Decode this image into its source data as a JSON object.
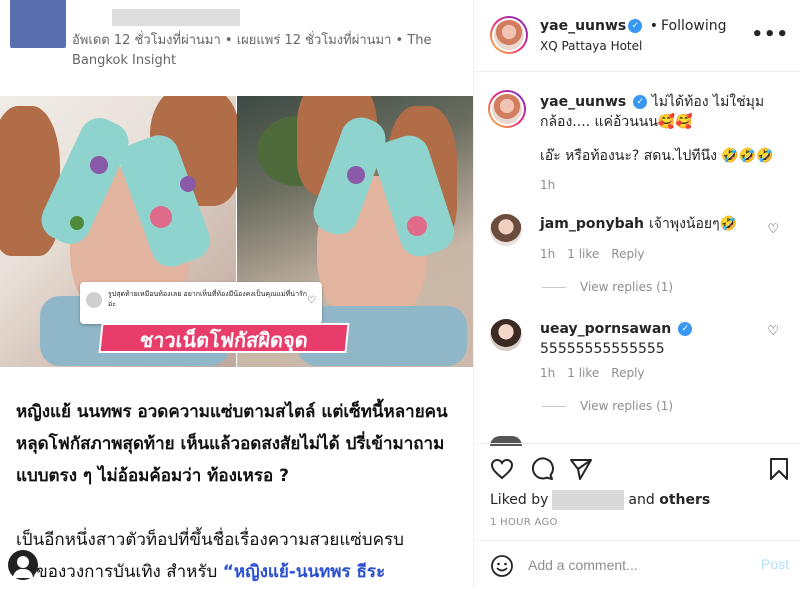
{
  "article": {
    "meta": "อัพเดต 12 ชั่วโมงที่ผ่านมา • เผยแพร่ 12 ชั่วโมงที่ผ่านมา • The Bangkok Insight",
    "image": {
      "overlay_comment": "รูปสุดท้ายเหมือนท้องเลย อยากเห็นที่ท้องมีน้องคงเป็นคุณแม่ที่น่ารักอ่ะ",
      "overlay_label": "ชาวเน็ตโฟกัสผิดจุด",
      "next_icon": "chevron-right-icon",
      "expand_icon": "expand-icon"
    },
    "headline": "หญิงแย้ นนทพร อวดความแซ่บตามสไตล์ แต่เซ็ทนี้หลายคนหลุดโฟกัสภาพสุดท้าย เห็นแล้วอดสงสัยไม่ได้ ปรี่เข้ามาถามแบบตรง ๆ ไม่อ้อมค้อมว่า ท้องเหรอ ?",
    "body_start": "เป็นอีกหนึ่งสาวตัวท็อปที่ขึ้นชื่อเรื่องความสวยแซ่บครบ",
    "body_cont": "ตรของวงการบันเทิง สำหรับ ",
    "body_link": "“หญิงแย้-นนทพร ธีระ",
    "link_color": "#2b4fd1"
  },
  "instagram": {
    "header": {
      "username": "yae_uunws",
      "follow_status": "Following",
      "location": "XQ Pattaya Hotel",
      "more_icon": "more-options-icon"
    },
    "caption": {
      "username": "yae_uunws",
      "text": "ไม่ได้ท้อง ไม่ใช่มุมกล้อง.... แค่อ้วนนน🥰🥰",
      "text2": "เอ๊ะ หรือท้องนะ? สดน.ไปทีนึง 🤣🤣🤣",
      "time": "1h"
    },
    "comments": [
      {
        "username": "jam_ponybah",
        "text": "เจ้าพุงน้อยๆ🤣",
        "time": "1h",
        "likes": "1 like",
        "reply": "Reply",
        "view_replies": "View replies (1)"
      },
      {
        "username": "ueay_pornsawan",
        "text": "55555555555555",
        "time": "1h",
        "likes": "1 like",
        "reply": "Reply",
        "view_replies": "View replies (1)"
      }
    ],
    "liked_by_prefix": "Liked by",
    "liked_by_suffix": "and",
    "liked_by_others": "others",
    "time_ago": "1 HOUR AGO",
    "add_comment_placeholder": "Add a comment...",
    "post_label": "Post",
    "verified_color": "#3897f0"
  }
}
